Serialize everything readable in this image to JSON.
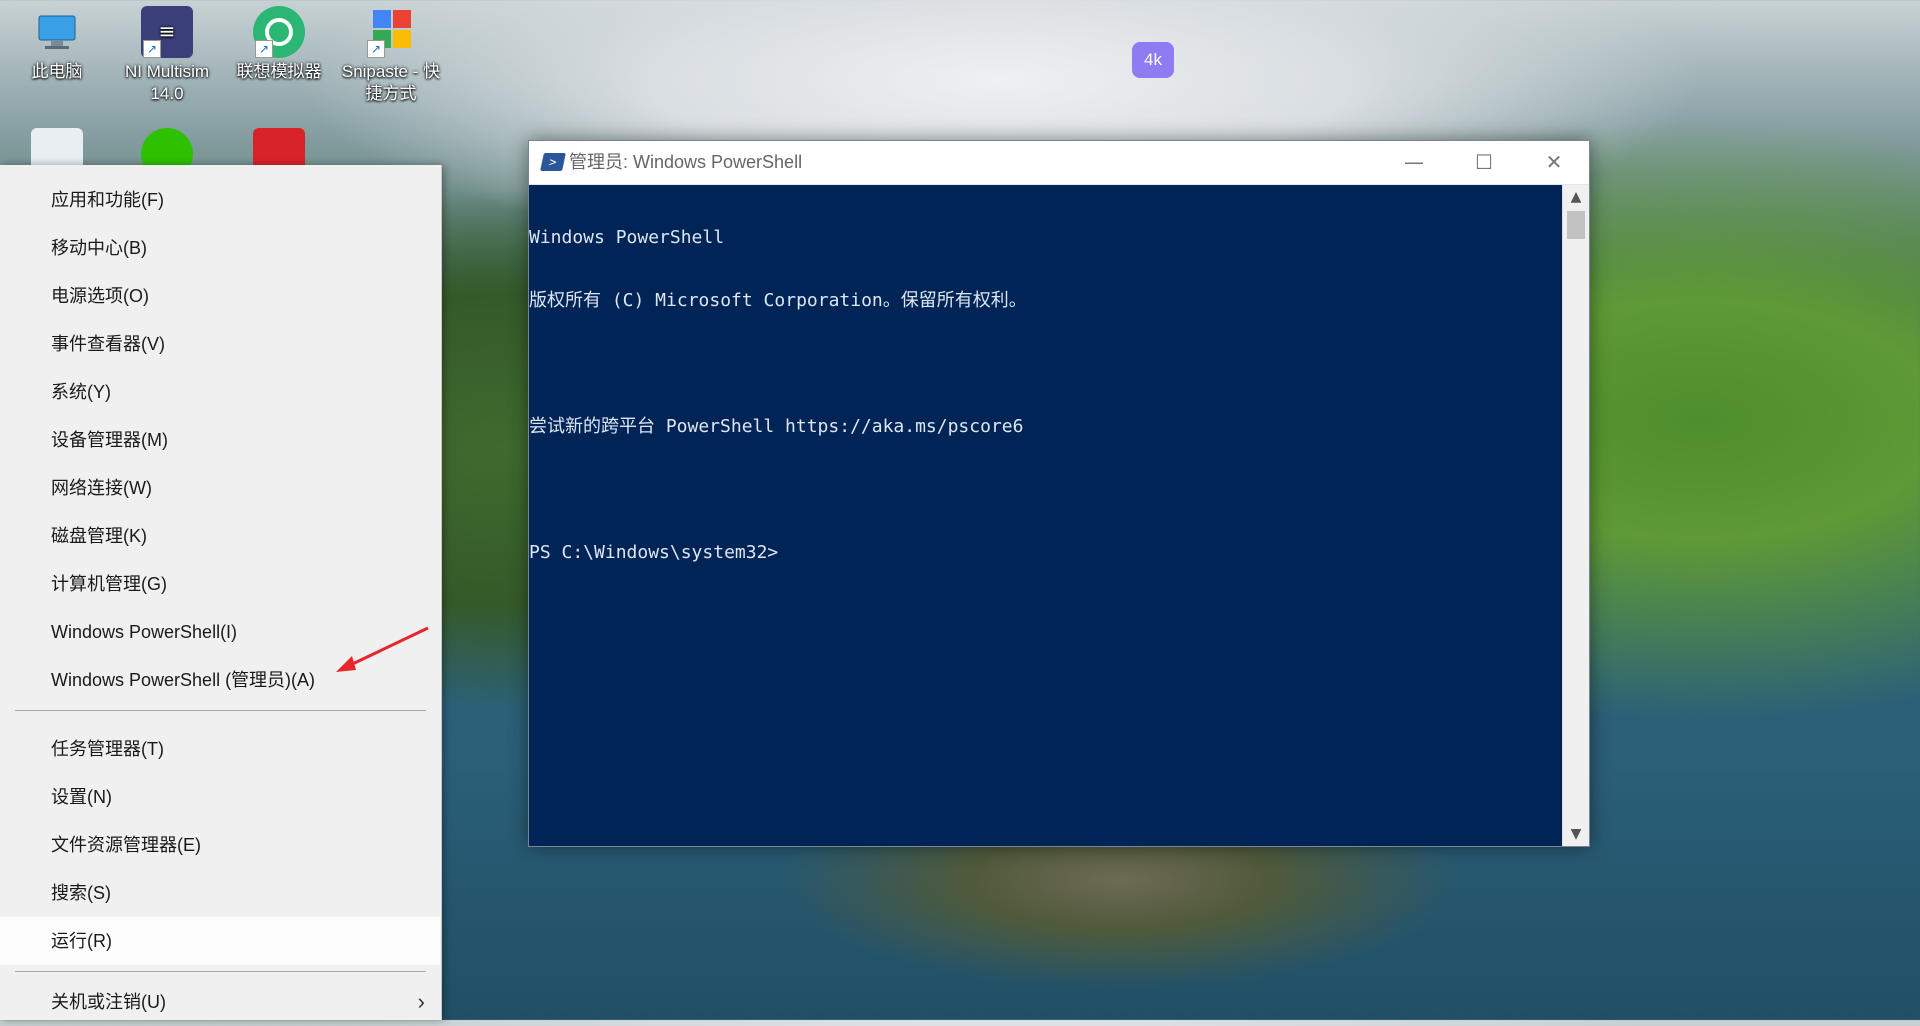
{
  "desktop": {
    "icons": [
      {
        "label": "此电脑",
        "icon": "computer-icon"
      },
      {
        "label": "NI Multisim 14.0",
        "icon": "multisim-icon"
      },
      {
        "label": "联想模拟器",
        "icon": "emulator-icon"
      },
      {
        "label": "Snipaste - 快捷方式",
        "icon": "snipaste-icon"
      },
      {
        "label": "",
        "icon": "recycle-bin-icon"
      },
      {
        "label": "",
        "icon": "wechat-icon"
      },
      {
        "label": "",
        "icon": "red-app-icon"
      },
      {
        "label": "4k",
        "icon": "tv-4k-icon"
      }
    ]
  },
  "menu": {
    "items": [
      {
        "label": "应用和功能(F)"
      },
      {
        "label": "移动中心(B)"
      },
      {
        "label": "电源选项(O)"
      },
      {
        "label": "事件查看器(V)"
      },
      {
        "label": "系统(Y)"
      },
      {
        "label": "设备管理器(M)"
      },
      {
        "label": "网络连接(W)"
      },
      {
        "label": "磁盘管理(K)"
      },
      {
        "label": "计算机管理(G)"
      },
      {
        "label": "Windows PowerShell(I)"
      },
      {
        "label": "Windows PowerShell (管理员)(A)"
      },
      {
        "label": "任务管理器(T)"
      },
      {
        "label": "设置(N)"
      },
      {
        "label": "文件资源管理器(E)"
      },
      {
        "label": "搜索(S)"
      },
      {
        "label": "运行(R)"
      },
      {
        "label": "关机或注销(U)"
      }
    ]
  },
  "powershell": {
    "title": "管理员: Windows PowerShell",
    "lines": [
      "Windows PowerShell",
      "版权所有 (C) Microsoft Corporation。保留所有权利。",
      "",
      "尝试新的跨平台 PowerShell https://aka.ms/pscore6",
      "",
      "PS C:\\Windows\\system32>"
    ],
    "minimize_glyph": "—",
    "maximize_glyph": "☐",
    "close_glyph": "✕"
  },
  "colors": {
    "console_bg": "#012456",
    "console_text": "#dde6f2",
    "arrow": "#e8252a"
  }
}
